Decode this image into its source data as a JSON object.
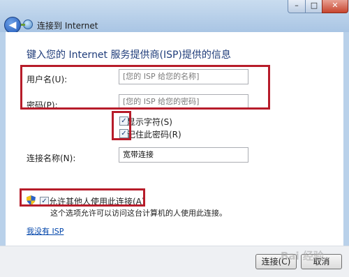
{
  "window": {
    "title": "连接到 Internet",
    "minimize_glyph": "–",
    "maximize_glyph": "□",
    "close_glyph": "✕",
    "back_glyph": "◀",
    "net_icon": "network-icon"
  },
  "main": {
    "heading": "键入您的 Internet 服务提供商(ISP)提供的信息",
    "username": {
      "label": "用户名(U):",
      "placeholder": "[您的 ISP 给您的名称]"
    },
    "password": {
      "label": "密码(P):",
      "placeholder": "[您的 ISP 给您的密码]"
    },
    "show_chars": {
      "label": "显示字符(S)",
      "checked": true
    },
    "remember_pw": {
      "label": "记住此密码(R)",
      "checked": true
    },
    "conn_name": {
      "label": "连接名称(N):",
      "value": "宽带连接"
    },
    "allow_others": {
      "label": "允许其他人使用此连接(A)",
      "checked": true,
      "icon": "shield-icon"
    },
    "allow_hint": "这个选项允许可以访问这台计算机的人使用此连接。",
    "no_isp_link": "我没有 ISP"
  },
  "footer": {
    "connect_label": "连接(C)",
    "cancel_label": "取消"
  },
  "watermark": "Bai 经验"
}
